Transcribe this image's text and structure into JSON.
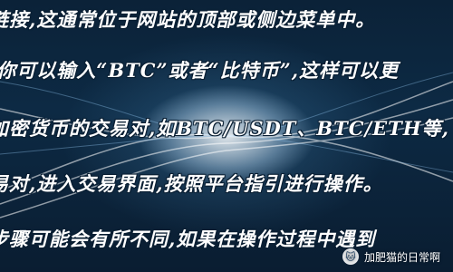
{
  "lines": [
    "链接,这通常位于网站的顶部或侧边菜单中。",
    ",你可以输入“BTC”或者“比特币”,这样可以更",
    "加密货币的交易对,如BTC/USDT、BTC/ETH等,",
    "易对,进入交易界面,按照平台指引进行操作。",
    "步骤可能会有所不同,如果在操作过程中遇到"
  ],
  "watermark": {
    "text": "加肥猫的日常啊",
    "icon": "cat-icon"
  },
  "colors": {
    "background": "#0a1f33",
    "text": "#ffffff"
  }
}
